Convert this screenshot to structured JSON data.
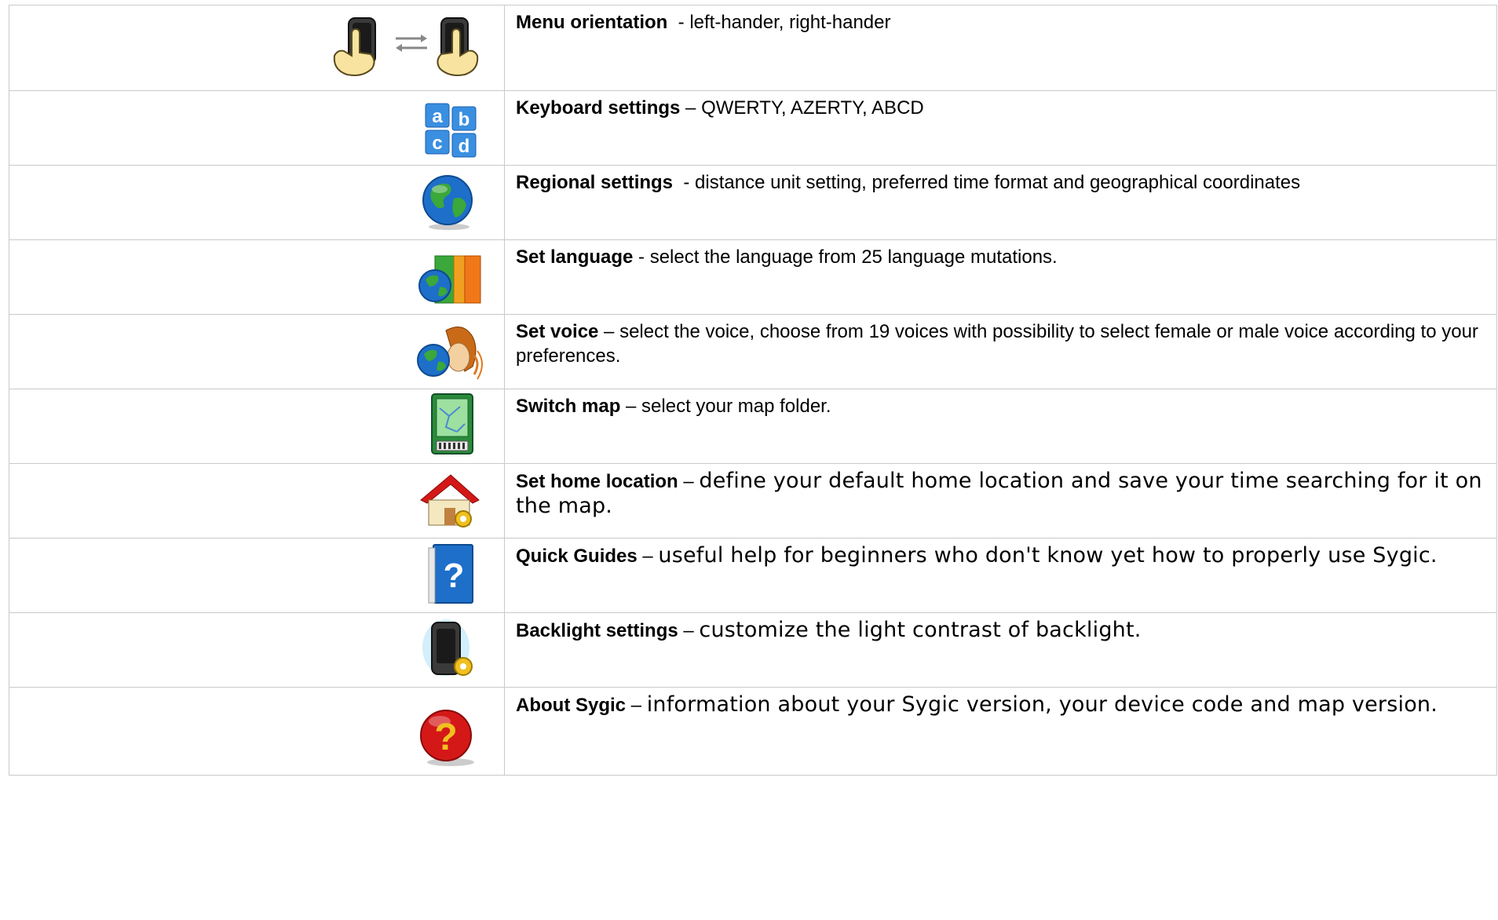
{
  "rows": [
    {
      "title": "Menu orientation",
      "separator": "  - ",
      "desc": "left-hander, right-hander",
      "icon": "hand-orientation-icon",
      "desc_style": "sans"
    },
    {
      "title": "Keyboard settings",
      "separator": " – ",
      "desc": "QWERTY, AZERTY, ABCD",
      "icon": "keyboard-abcd-icon",
      "desc_style": "sans"
    },
    {
      "title": "Regional settings",
      "separator": "  - ",
      "desc": "distance unit setting, preferred time format and geographical coordinates",
      "icon": "globe-icon",
      "desc_style": "sans"
    },
    {
      "title": "Set language",
      "separator": " - ",
      "desc": "select the language from 25 language mutations.",
      "icon": "language-book-icon",
      "desc_style": "sans"
    },
    {
      "title": "Set voice",
      "separator": " – ",
      "desc": "select the voice, choose from 19 voices with possibility to select female or male voice according to your preferences.",
      "icon": "voice-person-icon",
      "desc_style": "sans"
    },
    {
      "title": "Switch map",
      "separator": " – ",
      "desc": "select your map folder.",
      "icon": "map-card-icon",
      "desc_style": "sans"
    },
    {
      "title": "Set home location",
      "separator": " – ",
      "desc": "define your default home location and save your time searching for it on the map.",
      "icon": "home-gear-icon",
      "desc_style": "geo"
    },
    {
      "title": "Quick Guides",
      "separator": " – ",
      "desc": "useful help for beginners who don't know yet how to properly use Sygic.",
      "icon": "help-book-icon",
      "desc_style": "geo"
    },
    {
      "title": "Backlight settings",
      "separator": " – ",
      "desc": "customize the light contrast of backlight.",
      "icon": "backlight-device-icon",
      "desc_style": "geo"
    },
    {
      "title": "About Sygic",
      "separator": " – ",
      "desc": "information about your Sygic version, your device code and map version.",
      "icon": "about-question-icon",
      "desc_style": "geo"
    }
  ],
  "colors": {
    "border": "#c9c9c9",
    "globe_blue": "#1e6fc9",
    "land_green": "#3aa83a",
    "red": "#d41818",
    "gear_yellow": "#f0c020"
  }
}
